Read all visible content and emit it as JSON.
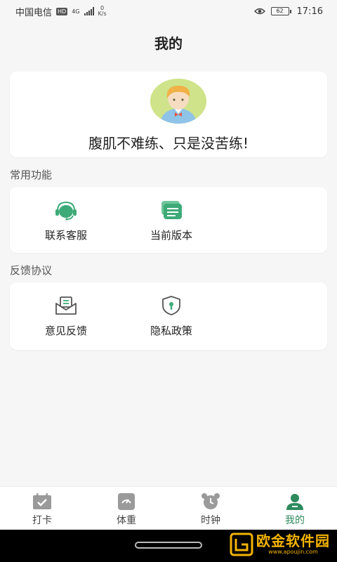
{
  "status_bar": {
    "carrier": "中国电信",
    "hd_badge": "HD",
    "network": "4G",
    "speed_value": "0",
    "speed_unit": "K/s",
    "battery": "62",
    "time": "17:16"
  },
  "header": {
    "title": "我的"
  },
  "profile": {
    "slogan": "腹肌不难练、只是没苦练!"
  },
  "sections": [
    {
      "label": "常用功能",
      "items": [
        {
          "label": "联系客服",
          "icon": "headset-icon"
        },
        {
          "label": "当前版本",
          "icon": "version-icon"
        }
      ]
    },
    {
      "label": "反馈协议",
      "items": [
        {
          "label": "意见反馈",
          "icon": "feedback-mail-icon"
        },
        {
          "label": "隐私政策",
          "icon": "privacy-shield-icon"
        }
      ]
    }
  ],
  "tabs": [
    {
      "label": "打卡",
      "icon": "calendar-check-icon",
      "active": false
    },
    {
      "label": "体重",
      "icon": "scale-icon",
      "active": false
    },
    {
      "label": "时钟",
      "icon": "alarm-clock-icon",
      "active": false
    },
    {
      "label": "我的",
      "icon": "user-icon",
      "active": true
    }
  ],
  "watermark": {
    "title": "欧金软件园",
    "url": "www.apoujin.com"
  },
  "colors": {
    "accent": "#2f8a5e",
    "icon_green": "#3daa78",
    "inactive_icon": "#9a9a9a"
  }
}
